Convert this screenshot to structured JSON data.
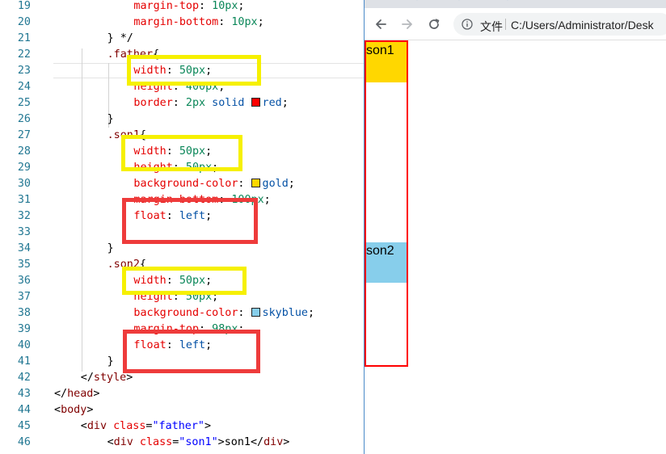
{
  "editor": {
    "lines": [
      {
        "n": "19",
        "indent": 6,
        "tokens": [
          [
            "prop",
            "margin-top"
          ],
          [
            "punc",
            ": "
          ],
          [
            "num",
            "10px"
          ],
          [
            "punc",
            ";"
          ]
        ]
      },
      {
        "n": "20",
        "indent": 6,
        "tokens": [
          [
            "prop",
            "margin-bottom"
          ],
          [
            "punc",
            ": "
          ],
          [
            "num",
            "10px"
          ],
          [
            "punc",
            ";"
          ]
        ]
      },
      {
        "n": "21",
        "indent": 4,
        "tokens": [
          [
            "punc",
            "} */"
          ]
        ]
      },
      {
        "n": "22",
        "indent": 4,
        "tokens": [
          [
            "sel",
            ".father"
          ],
          [
            "punc",
            "{"
          ]
        ]
      },
      {
        "n": "23",
        "indent": 6,
        "tokens": [
          [
            "prop",
            "width"
          ],
          [
            "punc",
            ": "
          ],
          [
            "num",
            "50px"
          ],
          [
            "punc",
            ";"
          ]
        ]
      },
      {
        "n": "24",
        "indent": 6,
        "tokens": [
          [
            "prop",
            "height"
          ],
          [
            "punc",
            ": "
          ],
          [
            "num",
            "400px"
          ],
          [
            "punc",
            ";"
          ]
        ]
      },
      {
        "n": "25",
        "indent": 6,
        "tokens": [
          [
            "prop",
            "border"
          ],
          [
            "punc",
            ": "
          ],
          [
            "num",
            "2px"
          ],
          [
            "punc",
            " "
          ],
          [
            "val",
            "solid"
          ],
          [
            "punc",
            " "
          ],
          [
            "swatch",
            "#ff0000"
          ],
          [
            "val",
            "red"
          ],
          [
            "punc",
            ";"
          ]
        ]
      },
      {
        "n": "26",
        "indent": 4,
        "tokens": [
          [
            "punc",
            "}"
          ]
        ]
      },
      {
        "n": "27",
        "indent": 4,
        "tokens": [
          [
            "sel",
            ".son1"
          ],
          [
            "punc",
            "{"
          ]
        ]
      },
      {
        "n": "28",
        "indent": 6,
        "tokens": [
          [
            "prop",
            "width"
          ],
          [
            "punc",
            ": "
          ],
          [
            "num",
            "50px"
          ],
          [
            "punc",
            ";"
          ]
        ]
      },
      {
        "n": "29",
        "indent": 6,
        "tokens": [
          [
            "prop",
            "height"
          ],
          [
            "punc",
            ": "
          ],
          [
            "num",
            "50px"
          ],
          [
            "punc",
            ";"
          ]
        ]
      },
      {
        "n": "30",
        "indent": 6,
        "tokens": [
          [
            "prop",
            "background-color"
          ],
          [
            "punc",
            ": "
          ],
          [
            "swatch",
            "#ffd700"
          ],
          [
            "val",
            "gold"
          ],
          [
            "punc",
            ";"
          ]
        ]
      },
      {
        "n": "31",
        "indent": 6,
        "tokens": [
          [
            "prop",
            "margin-bottom"
          ],
          [
            "punc",
            ": "
          ],
          [
            "num",
            "100px"
          ],
          [
            "punc",
            ";"
          ]
        ]
      },
      {
        "n": "32",
        "indent": 6,
        "tokens": [
          [
            "prop",
            "float"
          ],
          [
            "punc",
            ": "
          ],
          [
            "val",
            "left"
          ],
          [
            "punc",
            ";"
          ]
        ]
      },
      {
        "n": "33",
        "indent": 0,
        "tokens": []
      },
      {
        "n": "34",
        "indent": 4,
        "tokens": [
          [
            "punc",
            "}"
          ]
        ]
      },
      {
        "n": "35",
        "indent": 4,
        "tokens": [
          [
            "sel",
            ".son2"
          ],
          [
            "punc",
            "{"
          ]
        ]
      },
      {
        "n": "36",
        "indent": 6,
        "tokens": [
          [
            "prop",
            "width"
          ],
          [
            "punc",
            ": "
          ],
          [
            "num",
            "50px"
          ],
          [
            "punc",
            ";"
          ]
        ]
      },
      {
        "n": "37",
        "indent": 6,
        "tokens": [
          [
            "prop",
            "height"
          ],
          [
            "punc",
            ": "
          ],
          [
            "num",
            "50px"
          ],
          [
            "punc",
            ";"
          ]
        ]
      },
      {
        "n": "38",
        "indent": 6,
        "tokens": [
          [
            "prop",
            "background-color"
          ],
          [
            "punc",
            ": "
          ],
          [
            "swatch",
            "#87ceeb"
          ],
          [
            "val",
            "skyblue"
          ],
          [
            "punc",
            ";"
          ]
        ]
      },
      {
        "n": "39",
        "indent": 6,
        "tokens": [
          [
            "prop",
            "margin-top"
          ],
          [
            "punc",
            ": "
          ],
          [
            "num",
            "98px"
          ],
          [
            "punc",
            ";"
          ]
        ]
      },
      {
        "n": "40",
        "indent": 6,
        "tokens": [
          [
            "prop",
            "float"
          ],
          [
            "punc",
            ": "
          ],
          [
            "val",
            "left"
          ],
          [
            "punc",
            ";"
          ]
        ]
      },
      {
        "n": "41",
        "indent": 4,
        "tokens": [
          [
            "punc",
            "}"
          ]
        ]
      },
      {
        "n": "42",
        "indent": 2,
        "tokens": [
          [
            "punc",
            "</"
          ],
          [
            "tag",
            "style"
          ],
          [
            "punc",
            ">"
          ]
        ]
      },
      {
        "n": "43",
        "indent": 0,
        "tokens": [
          [
            "punc",
            "</"
          ],
          [
            "tag",
            "head"
          ],
          [
            "punc",
            ">"
          ]
        ]
      },
      {
        "n": "44",
        "indent": 0,
        "tokens": [
          [
            "punc",
            "<"
          ],
          [
            "tag",
            "body"
          ],
          [
            "punc",
            ">"
          ]
        ]
      },
      {
        "n": "45",
        "indent": 2,
        "tokens": [
          [
            "punc",
            "<"
          ],
          [
            "tag",
            "div"
          ],
          [
            "punc",
            " "
          ],
          [
            "attr",
            "class"
          ],
          [
            "punc",
            "="
          ],
          [
            "str",
            "\"father\""
          ],
          [
            "punc",
            ">"
          ]
        ]
      },
      {
        "n": "46",
        "indent": 4,
        "tokens": [
          [
            "punc",
            "<"
          ],
          [
            "tag",
            "div"
          ],
          [
            "punc",
            " "
          ],
          [
            "attr",
            "class"
          ],
          [
            "punc",
            "="
          ],
          [
            "str",
            "\"son1\""
          ],
          [
            "punc",
            ">son1</"
          ],
          [
            "tag",
            "div"
          ],
          [
            "punc",
            ">"
          ]
        ]
      }
    ]
  },
  "browser": {
    "omnibox": {
      "info_label": "文件",
      "url": "C:/Users/Administrator/Desk"
    },
    "page": {
      "son1_text": "son1",
      "son2_text": "son2",
      "father_border_color": "#ff0000",
      "son1_color": "#ffd700",
      "son2_color": "#87ceeb"
    }
  },
  "colors": {
    "highlight_yellow": "#f6f000",
    "highlight_red": "#ee3b3b"
  }
}
